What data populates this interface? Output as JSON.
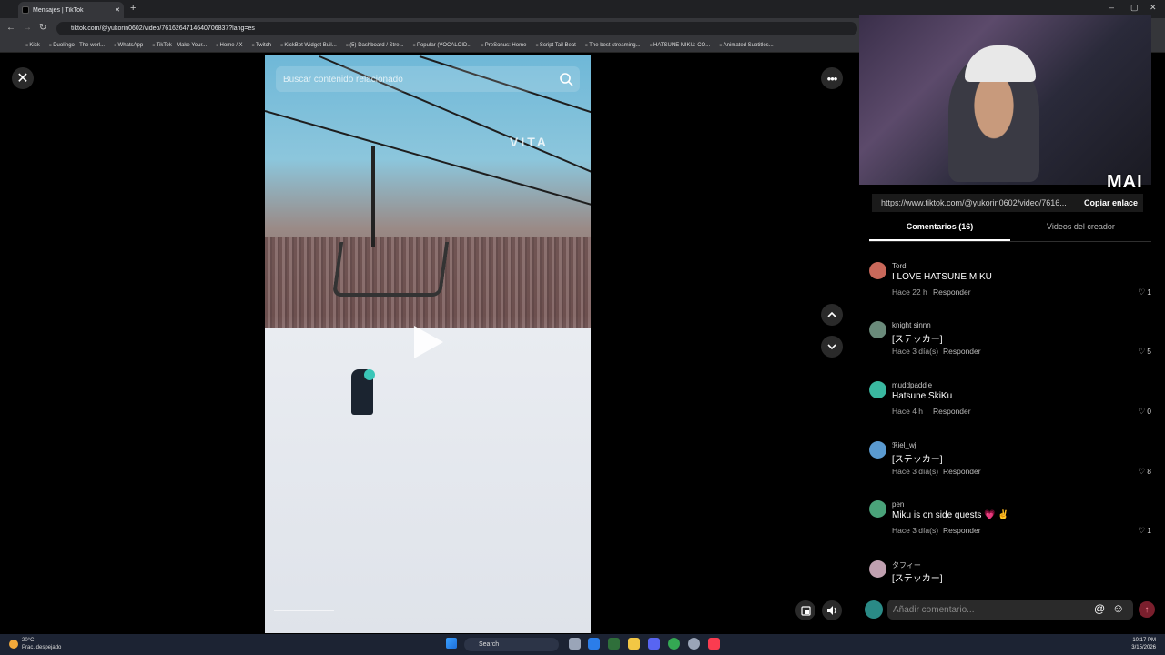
{
  "browser": {
    "tab_title": "Mensajes | TikTok",
    "new_tab": "+",
    "url": "tiktok.com/@yukorin0602/video/7616264714640706837?lang=es",
    "bookmarks": [
      "Kick",
      "Duolingo - The worl...",
      "WhatsApp",
      "TikTok - Make Your...",
      "Home / X",
      "Twitch",
      "KickBot Widget Buil...",
      "(5) Dashboard / Stre...",
      "Popular (VOCALOID...",
      "PreSonus: Home",
      "Script Tail Beat",
      "The best streaming...",
      "HATSUNE MIKU: CO...",
      "Animated Subtitles..."
    ]
  },
  "video": {
    "search_placeholder": "Buscar contenido relacionado",
    "watermark": "VITA"
  },
  "controls": {
    "close_label": "✕",
    "more_label": "•••"
  },
  "webcam": {
    "overlay_text": "MAI"
  },
  "panel": {
    "link_url": "https://www.tiktok.com/@yukorin0602/video/7616...",
    "copy_link": "Copiar enlace",
    "tab_comments": "Comentarios (16)",
    "tab_creator": "Videos del creador"
  },
  "comments": [
    {
      "user": "Tord",
      "text": "I LOVE HATSUNE MIKU",
      "time": "Hace 22 h",
      "reply": "Responder",
      "likes": "1",
      "avatar_color": "#c9685a"
    },
    {
      "user": "knight sinnn",
      "text": "[ステッカー]",
      "time": "Hace 3 día(s)",
      "reply": "Responder",
      "likes": "5",
      "avatar_color": "#6a8a7a"
    },
    {
      "user": "muddpaddle",
      "text": "Hatsune SkiKu",
      "time": "Hace 4 h",
      "reply": "Responder",
      "likes": "0",
      "avatar_color": "#3ab8a0"
    },
    {
      "user": "ℜiel_wj",
      "text": "[ステッカー]",
      "time": "Hace 3 día(s)",
      "reply": "Responder",
      "likes": "8",
      "avatar_color": "#5a9ad0"
    },
    {
      "user": "pen",
      "text": "Miku is on side quests 💗 ✌",
      "time": "Hace 3 día(s)",
      "reply": "Responder",
      "likes": "1",
      "avatar_color": "#4aa37a"
    },
    {
      "user": "タフィー",
      "text": "[ステッカー]",
      "time": "",
      "reply": "",
      "likes": "",
      "avatar_color": "#c0a0b0"
    }
  ],
  "comment_bar": {
    "placeholder": "Añadir comentario...",
    "at": "@",
    "emoji": "☺",
    "send": "↑"
  },
  "taskbar": {
    "temp": "20°C",
    "weather": "Prac. despejado",
    "search": "Search",
    "time": "10:17 PM",
    "date": "3/15/2026"
  }
}
